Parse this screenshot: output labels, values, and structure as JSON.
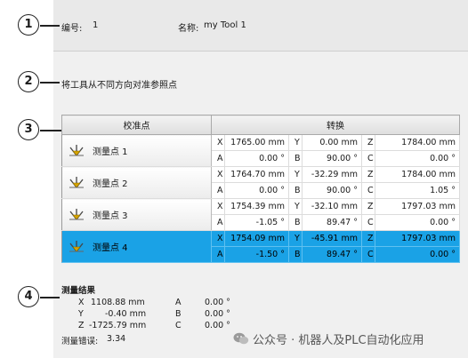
{
  "header": {
    "id_label": "编号:",
    "id_value": "1",
    "name_label": "名称:",
    "name_value": "my Tool 1"
  },
  "instruction": "将工具从不同方向对准参照点",
  "table": {
    "col_point": "校准点",
    "col_transform": "转换",
    "rows": [
      {
        "label": "测量点 1",
        "x": "1765.00 mm",
        "y": "0.00 mm",
        "z": "1784.00 mm",
        "a": "0.00 °",
        "b": "90.00 °",
        "c": "0.00 °",
        "selected": false
      },
      {
        "label": "测量点 2",
        "x": "1764.70 mm",
        "y": "-32.29 mm",
        "z": "1784.00 mm",
        "a": "0.00 °",
        "b": "90.00 °",
        "c": "1.05 °",
        "selected": false
      },
      {
        "label": "测量点 3",
        "x": "1754.39 mm",
        "y": "-32.10 mm",
        "z": "1797.03 mm",
        "a": "-1.05 °",
        "b": "89.47 °",
        "c": "0.00 °",
        "selected": false
      },
      {
        "label": "测量点 4",
        "x": "1754.09 mm",
        "y": "-45.91 mm",
        "z": "1797.03 mm",
        "a": "-1.50 °",
        "b": "89.47 °",
        "c": "0.00 °",
        "selected": true
      }
    ],
    "axis_labels": {
      "x": "X",
      "y": "Y",
      "z": "Z",
      "a": "A",
      "b": "B",
      "c": "C"
    }
  },
  "result": {
    "title": "测量结果",
    "x_label": "X",
    "x_value": "1108.88 mm",
    "y_label": "Y",
    "y_value": "-0.40 mm",
    "z_label": "Z",
    "z_value": "-1725.79 mm",
    "a_label": "A",
    "a_value": "0.00 °",
    "b_label": "B",
    "b_value": "0.00 °",
    "c_label": "C",
    "c_value": "0.00 °",
    "error_label": "测量错误:",
    "error_value": "3.34"
  },
  "callouts": [
    "1",
    "2",
    "3",
    "4"
  ],
  "watermark": "公众号 · 机器人及PLC自动化应用",
  "colors": {
    "selected_row": "#1aa2e6",
    "panel": "#f0f0f0"
  }
}
